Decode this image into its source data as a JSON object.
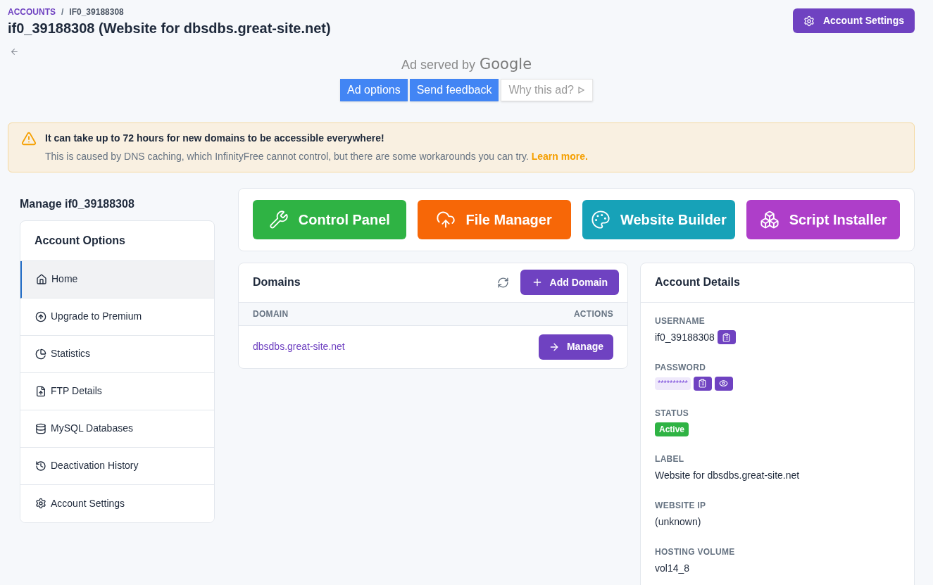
{
  "breadcrumb": [
    {
      "label": "ACCOUNTS",
      "link": true
    },
    {
      "label": "IF0_39188308",
      "link": false
    }
  ],
  "breadcrumb_separator": "/",
  "title": "if0_39188308 (Website for dbsdbs.great-site.net)",
  "header_button": "Account Settings",
  "ad": {
    "served_by": "Ad served by",
    "brand": "Google",
    "buttons": [
      {
        "label": "Ad options",
        "kind": "primary"
      },
      {
        "label": "Send feedback",
        "kind": "primary"
      },
      {
        "label": "Why this ad?",
        "kind": "plain"
      }
    ]
  },
  "alert": {
    "title": "It can take up to 72 hours for new domains to be accessible everywhere!",
    "message": "This is caused by DNS caching, which InfinityFree cannot control, but there are some workarounds you can try.",
    "link": "Learn more."
  },
  "sidebar": {
    "heading": "Manage if0_39188308",
    "card_title": "Account Options",
    "items": [
      {
        "label": "Home",
        "kind": "home",
        "selected": true
      },
      {
        "label": "Upgrade to Premium",
        "kind": "upgrade",
        "selected": false
      },
      {
        "label": "Statistics",
        "kind": "stats",
        "selected": false
      },
      {
        "label": "FTP Details",
        "kind": "ftp",
        "selected": false
      },
      {
        "label": "MySQL Databases",
        "kind": "db",
        "selected": false
      },
      {
        "label": "Deactivation History",
        "kind": "history",
        "selected": false
      },
      {
        "label": "Account Settings",
        "kind": "gear",
        "selected": false
      }
    ]
  },
  "tools": [
    {
      "label": "Control Panel",
      "kind": "wrench",
      "color": "#2fb344"
    },
    {
      "label": "File Manager",
      "kind": "cloud",
      "color": "#f76707"
    },
    {
      "label": "Website Builder",
      "kind": "palette",
      "color": "#17a2b8"
    },
    {
      "label": "Script Installer",
      "kind": "boxes",
      "color": "#ae3ec9"
    }
  ],
  "domains": {
    "title": "Domains",
    "add_button": "Add Domain",
    "columns": [
      "DOMAIN",
      "ACTIONS"
    ],
    "rows": [
      {
        "domain": "dbsdbs.great-site.net",
        "action": "Manage"
      }
    ]
  },
  "details": {
    "title": "Account Details",
    "fields": [
      {
        "label": "USERNAME",
        "value": "if0_39188308",
        "kind": "copy"
      },
      {
        "label": "PASSWORD",
        "value": "**********",
        "kind": "password"
      },
      {
        "label": "STATUS",
        "value": "Active",
        "kind": "badge"
      },
      {
        "label": "LABEL",
        "value": "Website for dbsdbs.great-site.net",
        "kind": "text"
      },
      {
        "label": "WEBSITE IP",
        "value": "(unknown)",
        "kind": "text"
      },
      {
        "label": "HOSTING VOLUME",
        "value": "vol14_8",
        "kind": "text"
      }
    ]
  }
}
